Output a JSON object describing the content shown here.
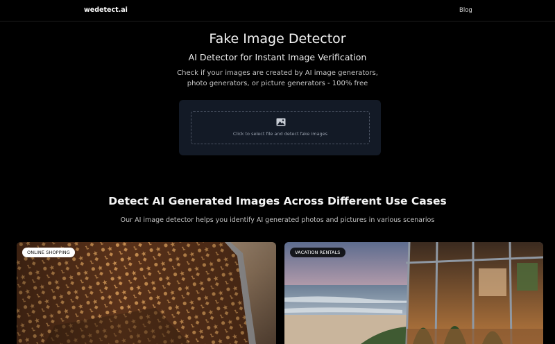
{
  "nav": {
    "logo": "wedetect.ai",
    "links": [
      {
        "label": "Blog"
      }
    ]
  },
  "hero": {
    "title": "Fake Image Detector",
    "subtitle": "AI Detector for Instant Image Verification",
    "description": "Check if your images are created by AI image generators, photo generators, or picture generators - 100% free"
  },
  "upload": {
    "icon": "image-icon",
    "prompt": "Click to select file and detect fake images"
  },
  "use_cases": {
    "title": "Detect AI Generated Images Across Different Use Cases",
    "subtitle": "Our AI image detector helps you identify AI generated photos and pictures in various scenarios",
    "cards": [
      {
        "label": "ONLINE SHOPPING"
      },
      {
        "label": "VACATION RENTALS"
      }
    ]
  },
  "colors": {
    "background": "#000000",
    "card": "#131a26",
    "dash_border": "#4b5363"
  }
}
